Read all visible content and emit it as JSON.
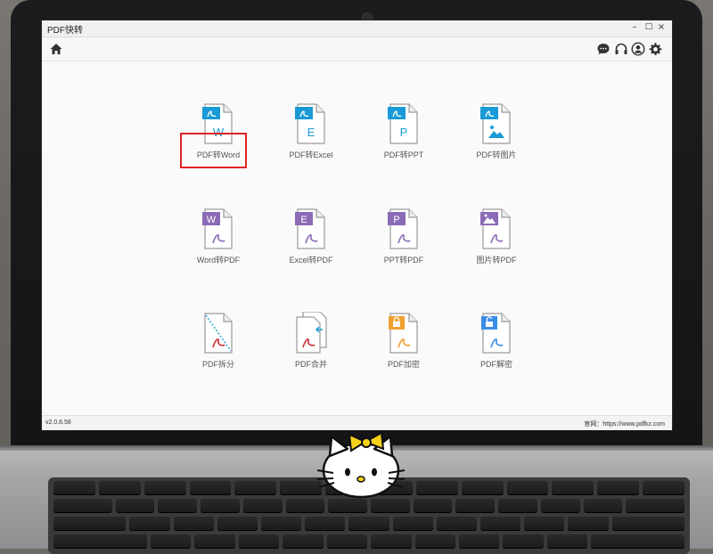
{
  "window": {
    "title": "PDF快转",
    "controls": {
      "minimize": "–",
      "maximize": "□",
      "close": "×"
    }
  },
  "toolbar": {
    "icons": [
      "home-icon",
      "chat-icon",
      "headset-icon",
      "user-icon",
      "gear-icon"
    ]
  },
  "tools": {
    "row1": [
      {
        "label": "PDF转Word",
        "badge": "W",
        "kind": "pdf-to"
      },
      {
        "label": "PDF转Excel",
        "badge": "E",
        "kind": "pdf-to"
      },
      {
        "label": "PDF转PPT",
        "badge": "P",
        "kind": "pdf-to"
      },
      {
        "label": "PDF转图片",
        "badge": "image",
        "kind": "pdf-to"
      }
    ],
    "row2": [
      {
        "label": "Word转PDF",
        "badge": "W",
        "kind": "to-pdf"
      },
      {
        "label": "Excel转PDF",
        "badge": "E",
        "kind": "to-pdf"
      },
      {
        "label": "PPT转PDF",
        "badge": "P",
        "kind": "to-pdf"
      },
      {
        "label": "图片转PDF",
        "badge": "image",
        "kind": "to-pdf"
      }
    ],
    "row3": [
      {
        "label": "PDF拆分",
        "kind": "split"
      },
      {
        "label": "PDF合并",
        "kind": "merge"
      },
      {
        "label": "PDF加密",
        "kind": "encrypt"
      },
      {
        "label": "PDF解密",
        "kind": "decrypt"
      }
    ]
  },
  "status": {
    "version": "v2.0.6.58",
    "website": "官网：https://www.pdfkz.com"
  },
  "colors": {
    "pdf_to_accent": "#1a9ad6",
    "to_pdf_accent": "#8b6bb5",
    "encrypt_lock": "#f0a030",
    "decrypt_lock": "#3a8ee6",
    "highlight": "#e02222",
    "acrobat_red": "#c8323a"
  }
}
